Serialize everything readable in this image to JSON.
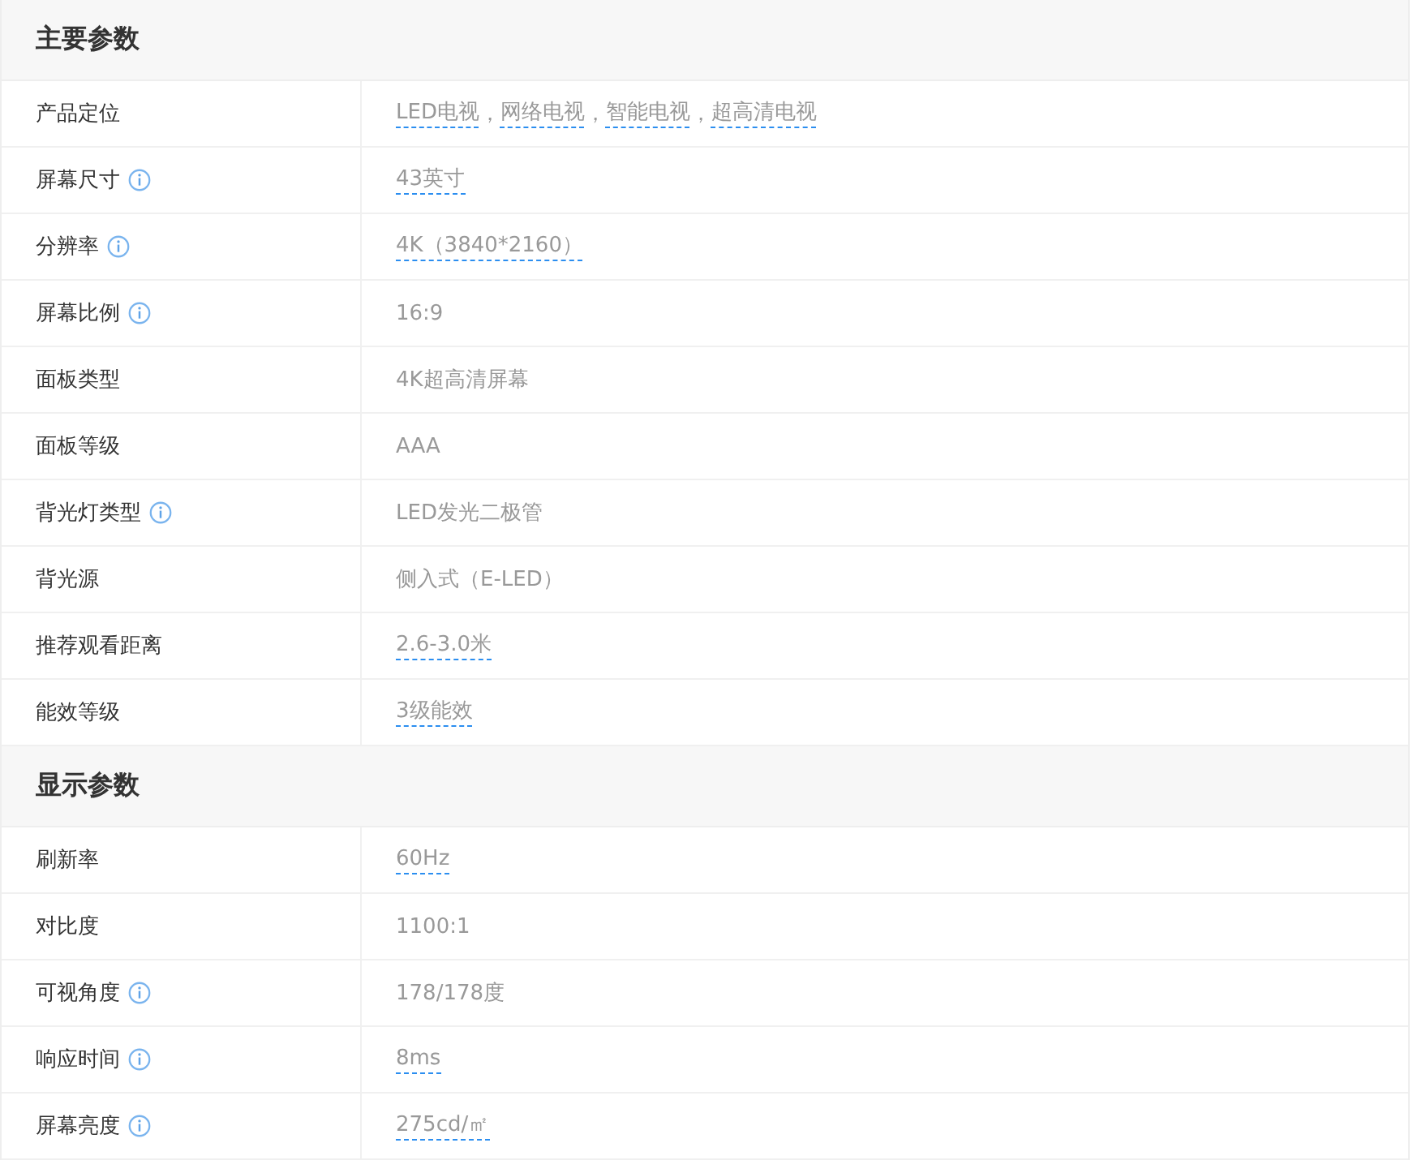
{
  "sections": [
    {
      "title": "主要参数",
      "rows": [
        {
          "label": "产品定位",
          "info": false,
          "value": [
            {
              "text": "LED电视",
              "linked": true
            },
            {
              "text": "，",
              "linked": false
            },
            {
              "text": "网络电视",
              "linked": true
            },
            {
              "text": "，",
              "linked": false
            },
            {
              "text": "智能电视",
              "linked": true
            },
            {
              "text": "，",
              "linked": false
            },
            {
              "text": "超高清电视",
              "linked": true
            }
          ]
        },
        {
          "label": "屏幕尺寸",
          "info": true,
          "value": [
            {
              "text": "43英寸",
              "linked": true
            }
          ]
        },
        {
          "label": "分辨率",
          "info": true,
          "value": [
            {
              "text": "4K（3840*2160）",
              "linked": true
            }
          ]
        },
        {
          "label": "屏幕比例",
          "info": true,
          "value": [
            {
              "text": "16:9",
              "linked": false
            }
          ]
        },
        {
          "label": "面板类型",
          "info": false,
          "value": [
            {
              "text": "4K超高清屏幕",
              "linked": false
            }
          ]
        },
        {
          "label": "面板等级",
          "info": false,
          "value": [
            {
              "text": "AAA",
              "linked": false
            }
          ]
        },
        {
          "label": "背光灯类型",
          "info": true,
          "value": [
            {
              "text": "LED发光二极管",
              "linked": false
            }
          ]
        },
        {
          "label": "背光源",
          "info": false,
          "value": [
            {
              "text": "侧入式（E-LED）",
              "linked": false
            }
          ]
        },
        {
          "label": "推荐观看距离",
          "info": false,
          "value": [
            {
              "text": "2.6-3.0米",
              "linked": true
            }
          ]
        },
        {
          "label": "能效等级",
          "info": false,
          "value": [
            {
              "text": "3级能效",
              "linked": true
            }
          ]
        }
      ]
    },
    {
      "title": "显示参数",
      "rows": [
        {
          "label": "刷新率",
          "info": false,
          "value": [
            {
              "text": "60Hz",
              "linked": true
            }
          ]
        },
        {
          "label": "对比度",
          "info": false,
          "value": [
            {
              "text": "1100:1",
              "linked": false
            }
          ]
        },
        {
          "label": "可视角度",
          "info": true,
          "value": [
            {
              "text": "178/178度",
              "linked": false
            }
          ]
        },
        {
          "label": "响应时间",
          "info": true,
          "value": [
            {
              "text": "8ms",
              "linked": true
            }
          ]
        },
        {
          "label": "屏幕亮度",
          "info": true,
          "value": [
            {
              "text": "275cd/㎡",
              "linked": true
            }
          ]
        }
      ]
    }
  ]
}
